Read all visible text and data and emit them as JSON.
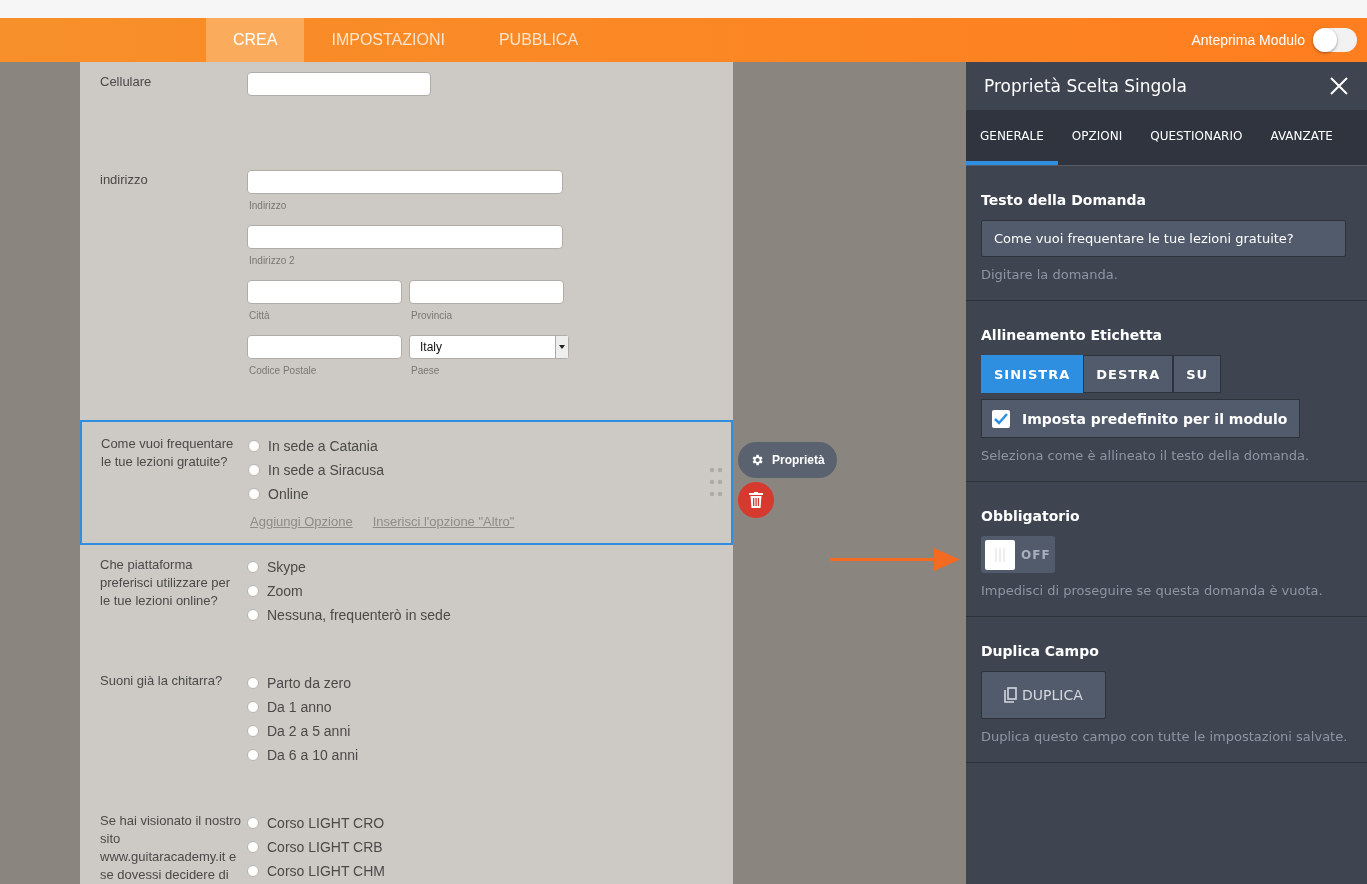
{
  "nav": {
    "tabs": [
      {
        "label": "CREA",
        "selected": true
      },
      {
        "label": "IMPOSTAZIONI",
        "selected": false
      },
      {
        "label": "PUBBLICA",
        "selected": false
      }
    ],
    "preview": {
      "label": "Anteprima Modulo",
      "on": false
    }
  },
  "form": {
    "fields": [
      {
        "kind": "text",
        "label": "Cellulare",
        "selected": false
      },
      {
        "kind": "address",
        "label": "indirizzo",
        "selected": false,
        "sublabels": [
          "Indirizzo",
          "Indirizzo 2",
          "Città",
          "Provincia",
          "Codice Postale",
          "Paese"
        ],
        "country": "Italy"
      },
      {
        "kind": "radio",
        "label": "Come vuoi frequentare le tue lezioni gratuite?",
        "selected": true,
        "options": [
          {
            "label": "In sede a Catania",
            "checked": false
          },
          {
            "label": "In sede a Siracusa",
            "checked": false
          },
          {
            "label": "Online",
            "checked": false
          }
        ],
        "links": [
          "Aggiungi Opzione",
          "Inserisci l'opzione \"Altro\""
        ]
      },
      {
        "kind": "radio",
        "label": "Che piattaforma preferisci utilizzare per le tue lezioni online?",
        "selected": false,
        "options": [
          {
            "label": "Skype",
            "checked": false
          },
          {
            "label": "Zoom",
            "checked": false
          },
          {
            "label": "Nessuna, frequenterò in sede",
            "checked": false
          }
        ]
      },
      {
        "kind": "radio",
        "label": "Suoni già la chitarra?",
        "selected": false,
        "options": [
          {
            "label": "Parto da zero",
            "checked": false
          },
          {
            "label": "Da 1 anno",
            "checked": false
          },
          {
            "label": "Da 2 a 5 anni",
            "checked": false
          },
          {
            "label": "Da 6 a 10 anni",
            "checked": false
          }
        ]
      },
      {
        "kind": "radio",
        "label": "Se hai visionato il nostro sito www.guitaracademy.it e se dovessi decidere di",
        "selected": false,
        "options": [
          {
            "label": "Corso LIGHT CRO",
            "checked": false
          },
          {
            "label": "Corso LIGHT CRB",
            "checked": false
          },
          {
            "label": "Corso LIGHT CHM",
            "checked": false
          }
        ]
      }
    ],
    "properties_button": "Proprietà"
  },
  "panel": {
    "title": "Proprietà Scelta Singola",
    "tabs": [
      {
        "label": "GENERALE",
        "selected": true
      },
      {
        "label": "OPZIONI",
        "selected": false
      },
      {
        "label": "QUESTIONARIO",
        "selected": false
      },
      {
        "label": "AVANZATE",
        "selected": false
      }
    ],
    "sections": [
      {
        "kind": "input",
        "title": "Testo della Domanda",
        "value": "Come vuoi frequentare le tue lezioni gratuite?",
        "hint": "Digitare la domanda."
      },
      {
        "kind": "align",
        "title": "Allineamento Etichetta",
        "options": [
          {
            "label": "SINISTRA",
            "selected": true
          },
          {
            "label": "DESTRA",
            "selected": false
          },
          {
            "label": "SU",
            "selected": false
          }
        ],
        "checkbox": {
          "label": "Imposta predefinito per il modulo",
          "checked": true
        },
        "hint": "Seleziona come è allineato il testo della domanda."
      },
      {
        "kind": "toggle",
        "title": "Obbligatorio",
        "on": false,
        "state_label": "OFF",
        "hint": "Impedisci di proseguire se questa domanda è vuota."
      },
      {
        "kind": "button",
        "title": "Duplica Campo",
        "button": "DUPLICA",
        "hint": "Duplica questo campo con tutte le impostazioni salvate."
      }
    ]
  }
}
